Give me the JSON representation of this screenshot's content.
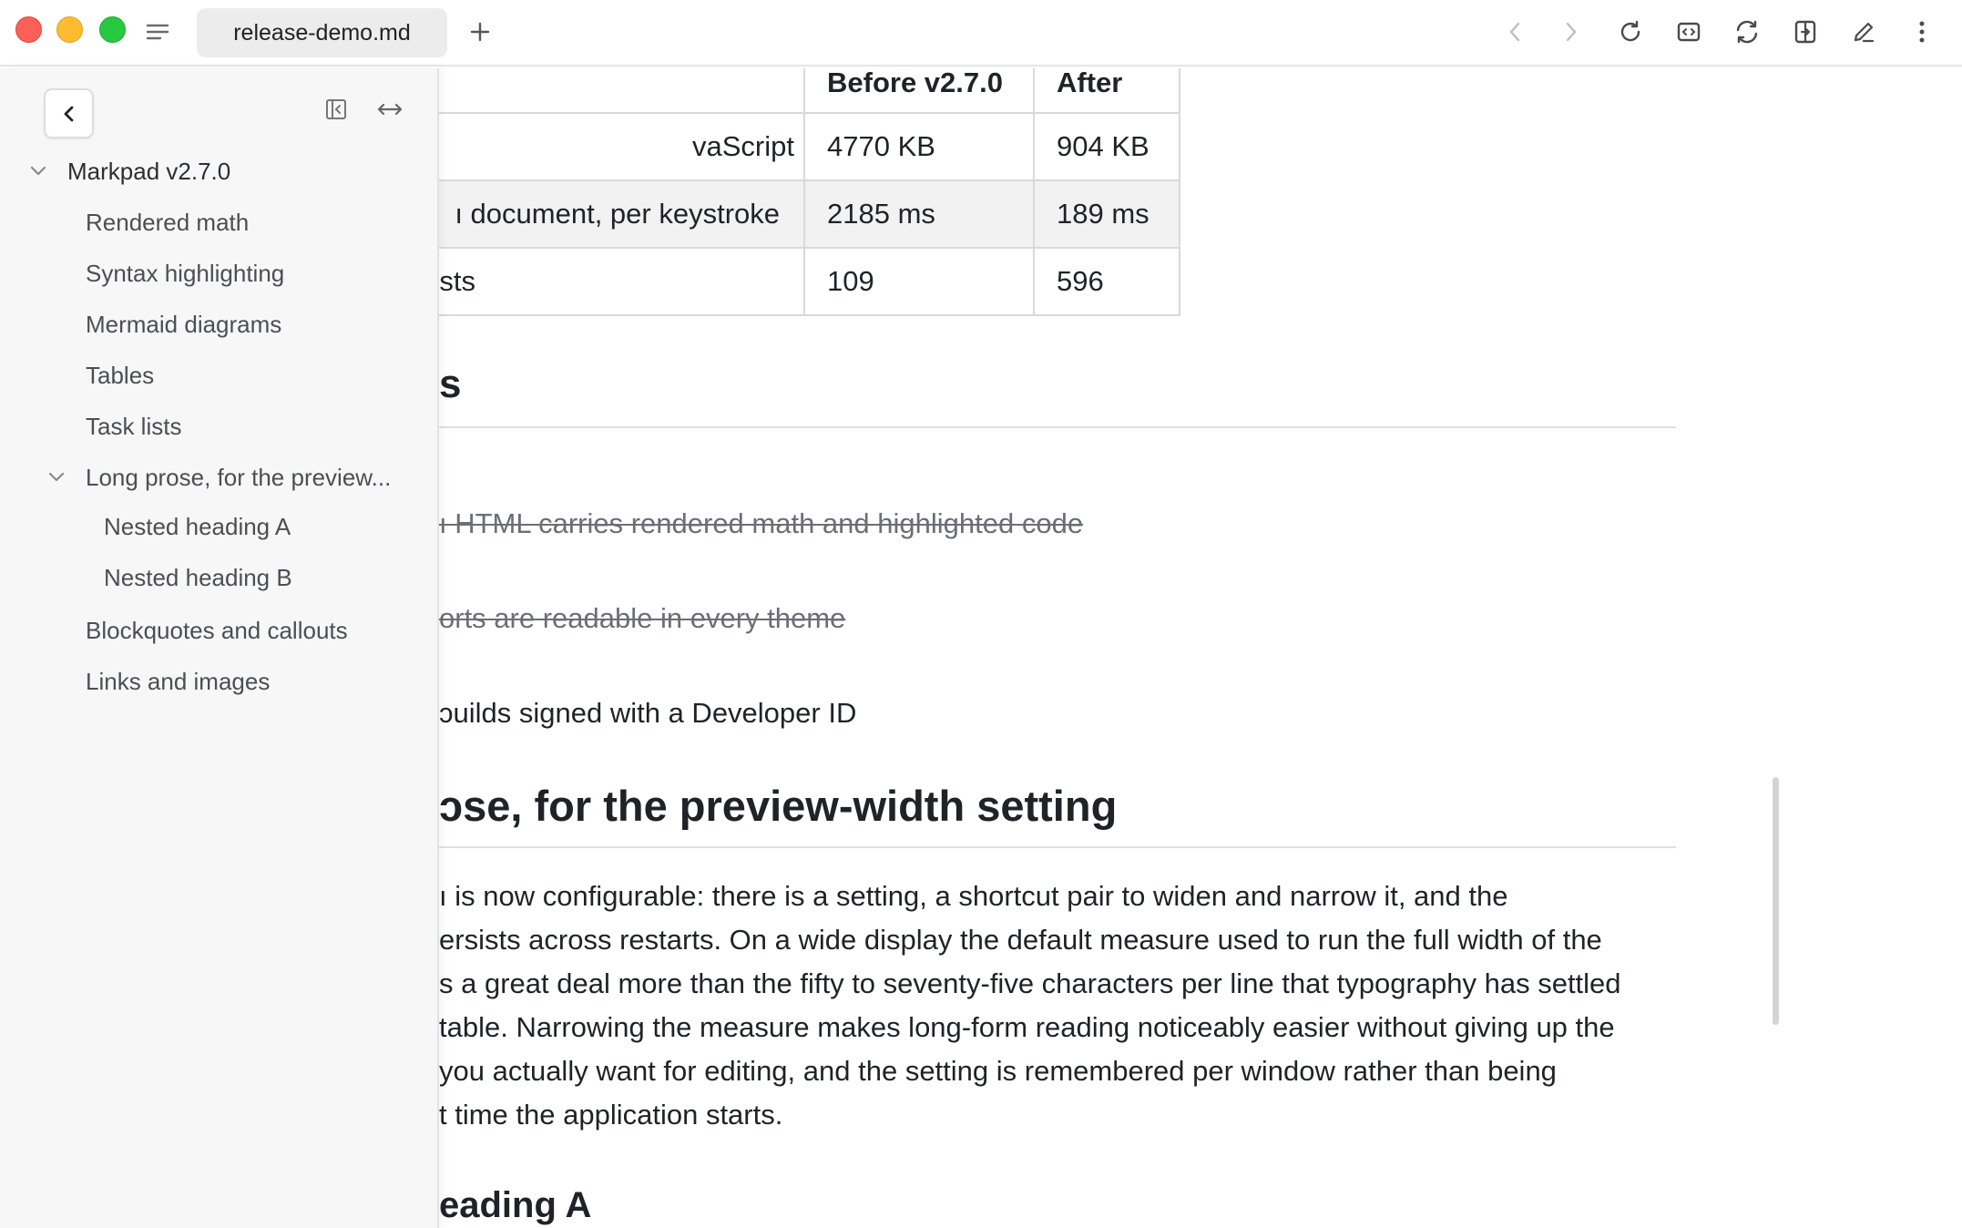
{
  "window": {
    "tab_title": "release-demo.md",
    "icons": [
      "sidebar-menu-icon",
      "plus-icon",
      "chevron-left-icon",
      "chevron-right-icon",
      "reload-icon",
      "source-view-icon",
      "sync-icon",
      "export-icon",
      "pencil-icon",
      "more-vertical-icon"
    ]
  },
  "sidebar": {
    "root": "Markpad v2.7.0",
    "items": [
      "Rendered math",
      "Syntax highlighting",
      "Mermaid diagrams",
      "Tables",
      "Task lists",
      "Long prose, for the preview...",
      "Nested heading A",
      "Nested heading B",
      "Blockquotes and callouts",
      "Links and images"
    ]
  },
  "doc": {
    "table": {
      "headers": [
        "",
        "Before v2.7.0",
        "After"
      ],
      "rows": [
        [
          "vaScript",
          "4770 KB",
          "904 KB"
        ],
        [
          "ı document, per keystroke",
          "2185 ms",
          "189 ms"
        ],
        [
          "ests",
          "109",
          "596"
        ]
      ]
    },
    "section_heading_partial": "s",
    "tasks": [
      {
        "text": "ı HTML carries rendered math and highlighted code",
        "done": true
      },
      {
        "text": "orts are readable in every theme",
        "done": true
      },
      {
        "text": "ɔuilds signed with a Developer ID",
        "done": false
      }
    ],
    "prose_heading": "ɔse, for the preview-width setting",
    "prose_lines": [
      "ı is now configurable: there is a setting, a shortcut pair to widen and narrow it, and the",
      "ersists across restarts. On a wide display the default measure used to run the full width of the",
      "s a great deal more than the fifty to seventy-five characters per line that typography has settled",
      "table. Narrowing the measure makes long-form reading noticeably easier without giving up the",
      "you actually want for editing, and the setting is remembered per window rather than being",
      "t time the application starts."
    ],
    "nested_heading": "eading A"
  },
  "colors": {
    "accent_red": "#fe5f57",
    "accent_yellow": "#febc2e",
    "accent_green": "#28c840",
    "sidebar_bg": "#f7f7f7",
    "text": "#1f2328"
  }
}
